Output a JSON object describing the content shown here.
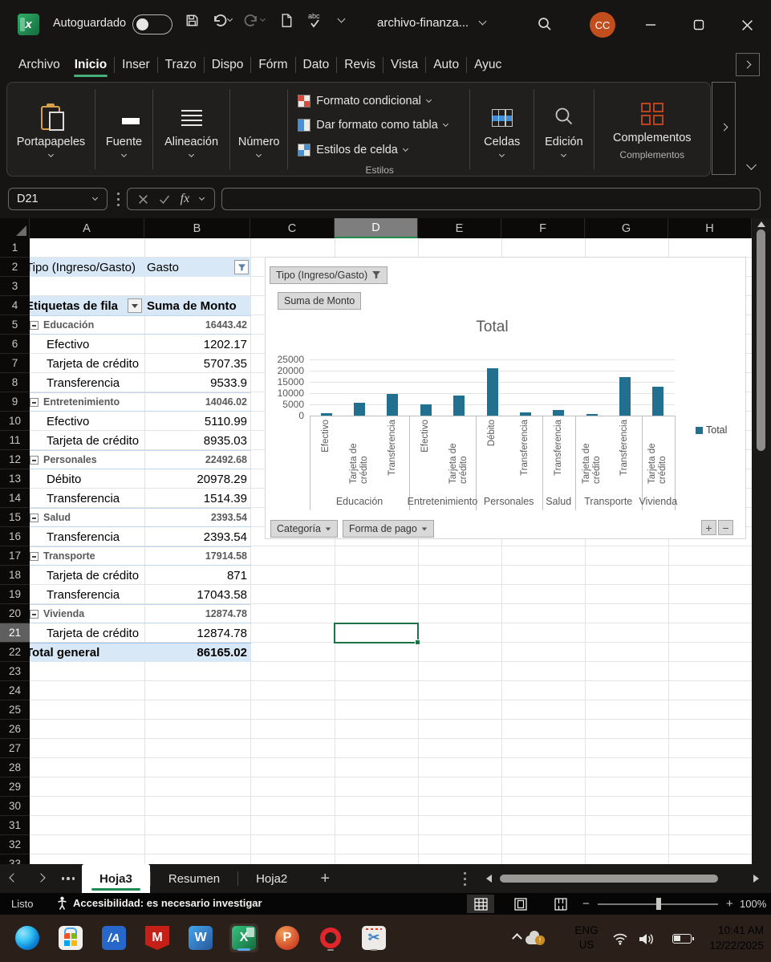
{
  "titlebar": {
    "autosave_label": "Autoguardado",
    "filename": "archivo-finanza...",
    "avatar": "CC"
  },
  "ribbon": {
    "tabs": [
      {
        "label": "Archivo",
        "selected": false
      },
      {
        "label": "Inicio",
        "selected": true
      },
      {
        "label": "Inser",
        "selected": false
      },
      {
        "label": "Trazo",
        "selected": false
      },
      {
        "label": "Dispo",
        "selected": false
      },
      {
        "label": "Fórm",
        "selected": false
      },
      {
        "label": "Dato",
        "selected": false
      },
      {
        "label": "Revis",
        "selected": false
      },
      {
        "label": "Vista",
        "selected": false
      },
      {
        "label": "Auto",
        "selected": false
      },
      {
        "label": "Ayuc",
        "selected": false
      }
    ],
    "big_buttons": [
      {
        "label": "Portapapeles",
        "icon": "clipboard-icon",
        "width": 110
      },
      {
        "label": "Fuente",
        "icon": "font-icon",
        "width": 72
      },
      {
        "label": "Alineación",
        "icon": "alignment-icon",
        "width": 96
      },
      {
        "label": "Número",
        "icon": "percent-icon",
        "width": 72
      }
    ],
    "style_buttons": [
      {
        "label": "Formato condicional",
        "icon": "conditional-format-icon"
      },
      {
        "label": "Dar formato como tabla",
        "icon": "format-table-icon"
      },
      {
        "label": "Estilos de celda",
        "icon": "cell-styles-icon"
      }
    ],
    "styles_group_label": "Estilos",
    "tall_buttons": [
      {
        "label": "Celdas",
        "icon": "cells-icon",
        "width": 80
      },
      {
        "label": "Edición",
        "icon": "edit-search-icon",
        "width": 74
      }
    ],
    "addins": {
      "label": "Complementos",
      "icon": "addins-icon",
      "group_label": "Complementos",
      "width": 146
    }
  },
  "formula_bar": {
    "cell_ref": "D21",
    "fx": "fx",
    "formula": ""
  },
  "grid": {
    "columns": [
      "A",
      "B",
      "C",
      "D",
      "E",
      "F",
      "G",
      "H"
    ],
    "selected_column": "D",
    "selected_row": 21,
    "visible_rows": 33
  },
  "pivot": {
    "filter_field": "Tipo (Ingreso/Gasto)",
    "filter_value": "Gasto",
    "row_header": "Etiquetas de fila",
    "value_header": "Suma de Monto",
    "start_row": 5,
    "rows": [
      {
        "label": "Educación",
        "value": "16443.42",
        "kind": "category"
      },
      {
        "label": "Efectivo",
        "value": "1202.17",
        "kind": "item"
      },
      {
        "label": "Tarjeta de crédito",
        "value": "5707.35",
        "kind": "item"
      },
      {
        "label": "Transferencia",
        "value": "9533.9",
        "kind": "item"
      },
      {
        "label": "Entretenimiento",
        "value": "14046.02",
        "kind": "category"
      },
      {
        "label": "Efectivo",
        "value": "5110.99",
        "kind": "item"
      },
      {
        "label": "Tarjeta de crédito",
        "value": "8935.03",
        "kind": "item"
      },
      {
        "label": "Personales",
        "value": "22492.68",
        "kind": "category"
      },
      {
        "label": "Débito",
        "value": "20978.29",
        "kind": "item"
      },
      {
        "label": "Transferencia",
        "value": "1514.39",
        "kind": "item"
      },
      {
        "label": "Salud",
        "value": "2393.54",
        "kind": "category"
      },
      {
        "label": "Transferencia",
        "value": "2393.54",
        "kind": "item"
      },
      {
        "label": "Transporte",
        "value": "17914.58",
        "kind": "category"
      },
      {
        "label": "Tarjeta de crédito",
        "value": "871",
        "kind": "item"
      },
      {
        "label": "Transferencia",
        "value": "17043.58",
        "kind": "item"
      },
      {
        "label": "Vivienda",
        "value": "12874.78",
        "kind": "category"
      },
      {
        "label": "Tarjeta de crédito",
        "value": "12874.78",
        "kind": "item"
      },
      {
        "label": "Total general",
        "value": "86165.02",
        "kind": "total"
      }
    ]
  },
  "chart_data": {
    "type": "bar",
    "title": "Total",
    "series_name": "Total",
    "legend_position": "right",
    "ylim": [
      0,
      25000
    ],
    "yticks": [
      0,
      5000,
      10000,
      15000,
      20000,
      25000
    ],
    "bar_color": "#21708F",
    "groups": [
      {
        "category": "Educación",
        "bars": [
          {
            "label": "Efectivo",
            "value": 1202.17
          },
          {
            "label": "Tarjeta de crédito",
            "value": 5707.35
          },
          {
            "label": "Transferencia",
            "value": 9533.9
          }
        ]
      },
      {
        "category": "Entretenimiento",
        "bars": [
          {
            "label": "Efectivo",
            "value": 5110.99
          },
          {
            "label": "Tarjeta de crédito",
            "value": 8935.03
          }
        ]
      },
      {
        "category": "Personales",
        "bars": [
          {
            "label": "Débito",
            "value": 20978.29
          },
          {
            "label": "Transferencia",
            "value": 1514.39
          }
        ]
      },
      {
        "category": "Salud",
        "bars": [
          {
            "label": "Transferencia",
            "value": 2393.54
          }
        ]
      },
      {
        "category": "Transporte",
        "bars": [
          {
            "label": "Tarjeta de crédito",
            "value": 871
          },
          {
            "label": "Transferencia",
            "value": 17043.58
          }
        ]
      },
      {
        "category": "Vivienda",
        "bars": [
          {
            "label": "Tarjeta de crédito",
            "value": 12874.78
          }
        ]
      }
    ],
    "filter_button": "Tipo (Ingreso/Gasto)",
    "value_button": "Suma de Monto",
    "axis_buttons": [
      "Categoría",
      "Forma de pago"
    ]
  },
  "sheet_tabs": {
    "tabs": [
      {
        "label": "Hoja3",
        "active": true
      },
      {
        "label": "Resumen",
        "active": false
      },
      {
        "label": "Hoja2",
        "active": false
      }
    ]
  },
  "status_bar": {
    "mode": "Listo",
    "accessibility": "Accesibilidad: es necesario investigar",
    "zoom": "100%"
  },
  "taskbar": {
    "icons": [
      "edge-icon",
      "store-icon",
      "ace-icon",
      "mcafee-icon",
      "word-icon",
      "excel-task-icon",
      "powerpoint-icon",
      "opera-icon",
      "snip-icon"
    ],
    "active_icon": "excel-task-icon",
    "running_icons": [
      "opera-icon",
      "snip-icon"
    ],
    "language_line1": "ENG",
    "language_line2": "US",
    "time": "10:41 AM",
    "date": "12/22/2025"
  }
}
